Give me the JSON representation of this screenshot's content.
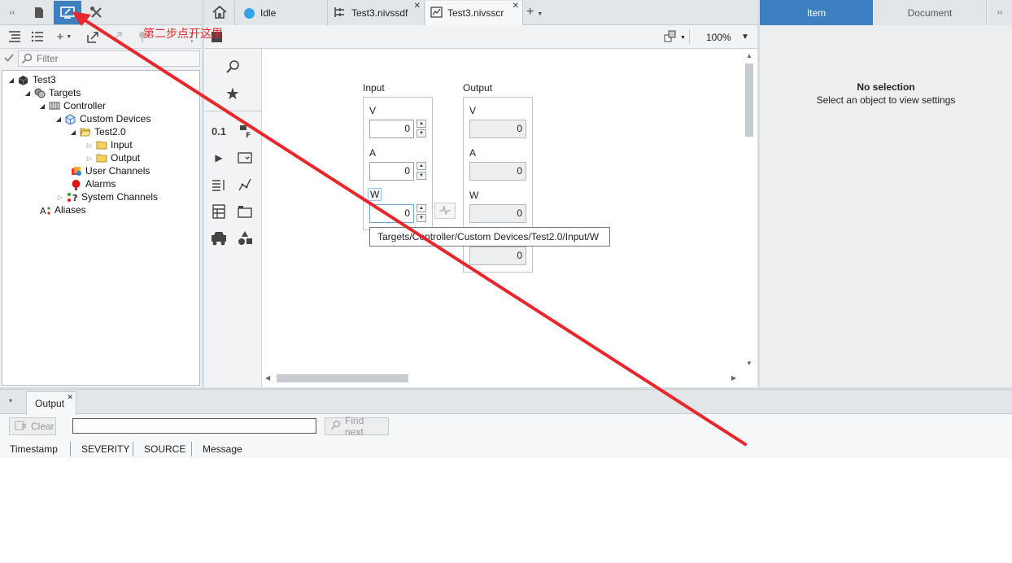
{
  "left_panel": {
    "toolbar_add_label": "+",
    "filter_placeholder": "Filter",
    "tree": [
      {
        "label": "Test3"
      },
      {
        "label": "Targets"
      },
      {
        "label": "Controller"
      },
      {
        "label": "Custom Devices"
      },
      {
        "label": "Test2.0"
      },
      {
        "label": "Input"
      },
      {
        "label": "Output"
      },
      {
        "label": "User Channels"
      },
      {
        "label": "Alarms"
      },
      {
        "label": "System Channels"
      },
      {
        "label": "Aliases"
      }
    ]
  },
  "center": {
    "tabs": [
      {
        "label": "Idle"
      },
      {
        "label": "Test3.nivssdf"
      },
      {
        "label": "Test3.nivsscr"
      }
    ],
    "zoom": "100%",
    "palette": {
      "numeric_label": "0.1"
    },
    "input_group": {
      "title": "Input",
      "fields": [
        {
          "label": "V",
          "value": "0"
        },
        {
          "label": "A",
          "value": "0"
        },
        {
          "label": "W",
          "value": "0"
        }
      ]
    },
    "output_group": {
      "title": "Output",
      "fields": [
        {
          "label": "V",
          "value": "0"
        },
        {
          "label": "A",
          "value": "0"
        },
        {
          "label": "W",
          "value": "0"
        },
        {
          "label": "",
          "value": "0"
        }
      ]
    },
    "tooltip": "Targets/Controller/Custom Devices/Test2.0/Input/W"
  },
  "right_panel": {
    "tabs": [
      "Item",
      "Document"
    ],
    "empty_title": "No selection",
    "empty_subtitle": "Select an object to view settings"
  },
  "bottom": {
    "tab_label": "Output",
    "clear_label": "Clear",
    "search_value": "",
    "find_next_label": "Find next",
    "columns": [
      "Timestamp",
      "SEVERITY",
      "SOURCE",
      "Message"
    ]
  },
  "annotation": "第二步点开这里",
  "colors": {
    "accent": "#3c80c2",
    "annotation": "#e8262b"
  }
}
